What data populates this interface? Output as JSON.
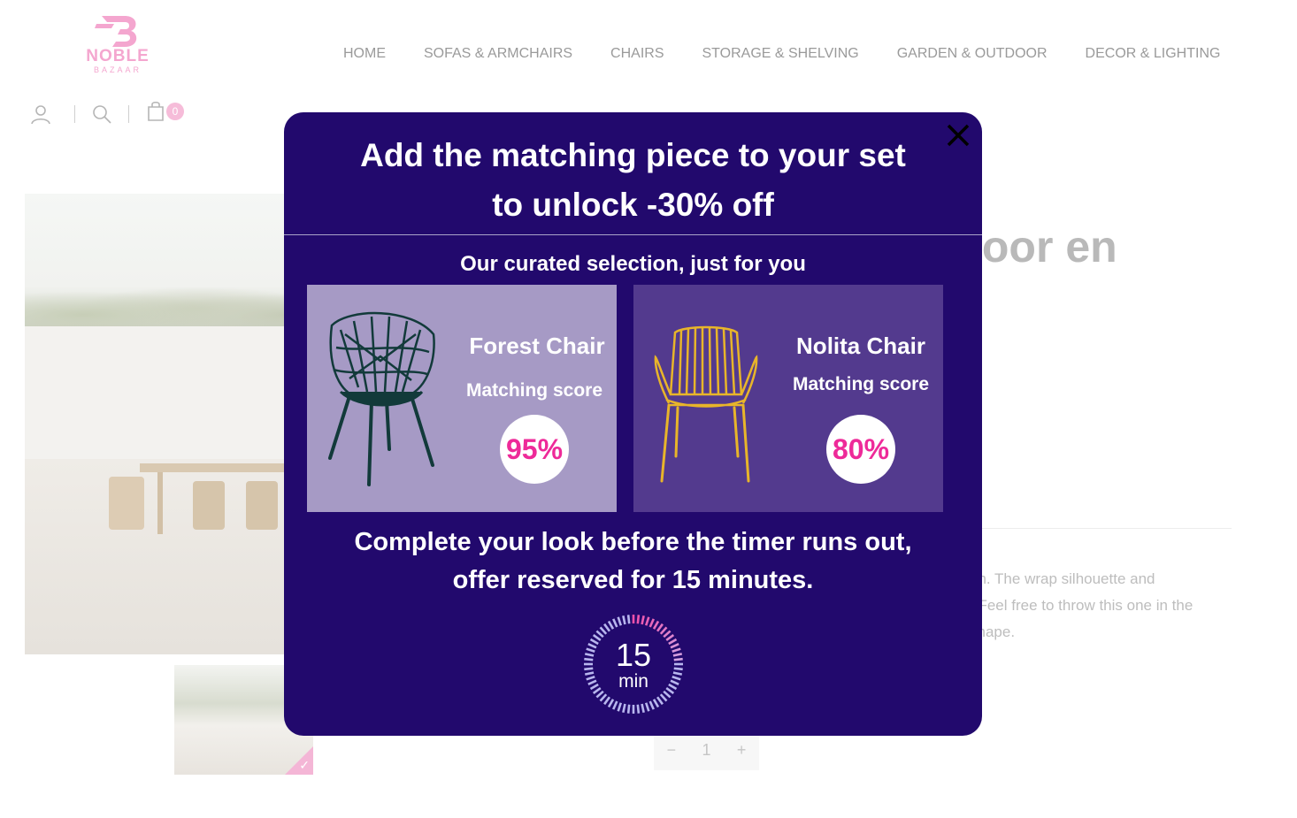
{
  "brand": {
    "name": "NOBLE",
    "sub": "BAZAAR",
    "color": "#f4a6cf"
  },
  "nav": {
    "items": [
      "HOME",
      "SOFAS & ARMCHAIRS",
      "CHAIRS",
      "STORAGE & SHELVING",
      "GARDEN & OUTDOOR",
      "DECOR & LIGHTING"
    ]
  },
  "utility": {
    "icons": [
      "user-icon",
      "search-icon",
      "cart-icon"
    ],
    "cart_count": "0"
  },
  "background": {
    "product_title_partial": "loor en",
    "description_partial": "on. The wrap silhouette and . Feel free to throw this one in the shape.",
    "desc_lines": [
      "on. The wrap silhouette and",
      ". Feel free to throw this one in the",
      "shape."
    ],
    "quantity": {
      "minus": "−",
      "value": "1",
      "plus": "+"
    }
  },
  "modal": {
    "title_line1": "Add the matching piece to your set",
    "title_line2": "to unlock -30% off",
    "subtitle": "Our curated selection, just for you",
    "cards": [
      {
        "name": "Forest Chair",
        "score_label": "Matching score",
        "score": "95%",
        "bg": "#a69ac5",
        "chair_color": "#123a3a"
      },
      {
        "name": "Nolita Chair",
        "score_label": "Matching score",
        "score": "80%",
        "bg": "#533a8e",
        "chair_color": "#e8b52a"
      }
    ],
    "cta_line1": "Complete your look before the timer runs out,",
    "cta_line2": "offer reserved for 15 minutes.",
    "timer": {
      "value": "15",
      "unit": "min"
    },
    "colors": {
      "background": "#22096d",
      "score_text": "#ee2a99"
    }
  }
}
